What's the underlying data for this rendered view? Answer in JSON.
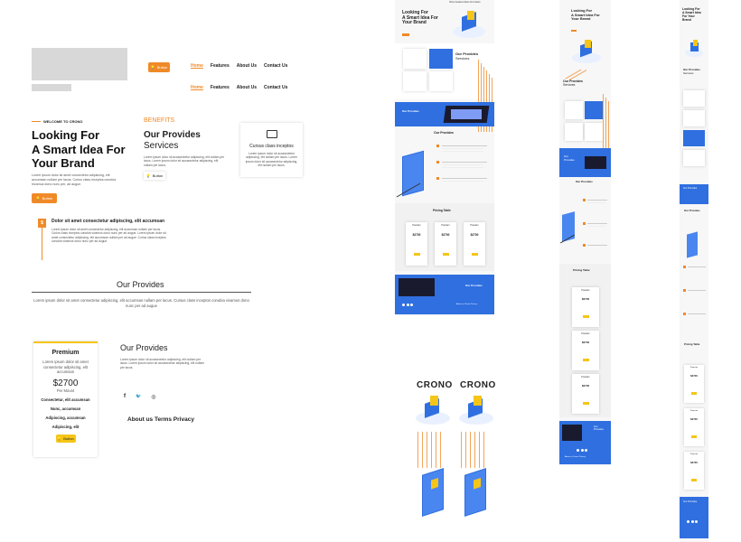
{
  "main": {
    "nav_a": {
      "home": "Home",
      "features": "Features",
      "about": "About Us",
      "contact": "Contact Us"
    },
    "nav_b": {
      "home": "Home",
      "features": "Features",
      "about": "About Us",
      "contact": "Contact Us"
    },
    "header_button": "Button",
    "hero": {
      "kicker": "WELCOME TO CRONO",
      "title_line1": "Looking For",
      "title_line2": "A Smart Idea For",
      "title_line3": "Your Brand",
      "body": "Lorem ipsum dolor sit amet consectetur adipiscing, elit accumsan nullam per lacus. Curlus class inceptos conubia hivamus dono nunc per, ad augue.",
      "button": "Button"
    },
    "benefits": {
      "kicker": "BENEFITS",
      "title_line1": "Our Provides",
      "title_line2": "Services",
      "body": "Lorem ipsum dolor sit accasectetur adipiscing, elit nullam per lacus. Lorem ipsum dolor sit accasectetur adipiscing, elit nullam per lacus.",
      "button": "Button"
    },
    "feature_card": {
      "title": "Cursus class inceptos",
      "body": "Lorem ipsum dolor sit accasectetur adipiscing, elit nullam per lacus. Lorem ipsum dolor sit accasectetur adipiscing, elit nullam per lacus."
    },
    "feature_item": {
      "icon_text": "$",
      "title": "Dolor sit amet consectetur adipiscing, elit accumsan",
      "body": "Lorem ipsum dolor sit amet consectetur adipiscing, elit accumsan nullam per lacus. Curlus class inceptos conubia vivamus dono nunc per ad augue. Lorem ipsum dolor sit amet consectetur adipiscing, elit accumsan nullam per ad augue. Curlus class inceptos conubia vivamus dono nunc per ad augue."
    },
    "provides": {
      "title": "Our Provides",
      "body": "Lorem ipsum dolor sit amet consectetur adipiscing, elit accumsan nullam per lacus. Cursus class inceptos conubia vivamus dono nunc per ad augue"
    },
    "pricing": {
      "name": "Premium",
      "desc": "Lorem ipsum dolor sit amet consectetur adipiscing, elit accumsan",
      "price": "$2700",
      "period": "Per Mount",
      "feature1": "Consectetur, elit accumsan",
      "feature2": "Nunc, accumsan",
      "feature3": "Adipiscing, accumsan",
      "feature4": "Adipiscing, elit",
      "button": "Button"
    },
    "provides2": {
      "title": "Our Provides",
      "body": "Lorem ipsum dolor sit accasectetur adipiscing, elit nullam per lacus. Lorem ipsum dolor sit accasectetur adipiscing, elit nullam per lacus."
    },
    "social": {
      "facebook": "f",
      "twitter": "🐦",
      "instagram": "◎"
    },
    "footer_links": "About us Terms Privacy"
  },
  "preview_desktop": {
    "hero_title_line1": "Looking For",
    "hero_title_line2": "A Smart Idea For",
    "hero_title_line3": "Your Brand",
    "services_title": "Our Provides",
    "services_sub": "Services",
    "blue_banner": "Our Provides",
    "provides": "Our Provides",
    "pricing_title": "Pricing Table",
    "plans": [
      {
        "name": "Premium",
        "price": "$2700"
      },
      {
        "name": "Premium",
        "price": "$2700"
      },
      {
        "name": "Premium",
        "price": "$2700"
      }
    ],
    "footer_banner": "Our Provides",
    "footer_links": "About us Terms Privacy"
  },
  "preview_tablet": {
    "hero_title_line1": "Looking For",
    "hero_title_line2": "A Smart Idea For",
    "hero_title_line3": "Your Brand",
    "services_title": "Our Provides",
    "services_sub": "Services",
    "blue_card": "Our Provides",
    "provides": "Our Provides",
    "pricing_title": "Pricing Table",
    "plans": [
      {
        "name": "Premium",
        "price": "$2700"
      },
      {
        "name": "Premium",
        "price": "$2700"
      },
      {
        "name": "Premium",
        "price": "$2700"
      }
    ],
    "footer_banner": "Our Provides",
    "footer_links": "About us Terms Privacy"
  },
  "preview_mobile": {
    "hero_title_line1": "Looking For",
    "hero_title_line2": "A Smart Idea",
    "hero_title_line3": "For Your",
    "hero_title_line4": "Brand",
    "services_title": "Our Provides",
    "services_sub": "Services",
    "blue_card": "Our Provides",
    "provides": "Our Provides",
    "pricing_title": "Pricing Table",
    "plans": [
      {
        "name": "Premium",
        "price": "$2700"
      },
      {
        "name": "Premium",
        "price": "$2700"
      },
      {
        "name": "Premium",
        "price": "$2700"
      }
    ],
    "footer_banner": "Our Provides"
  },
  "logos": {
    "logo1": "CRONO",
    "logo2": "CRONO"
  },
  "colors": {
    "accent": "#f08a28",
    "blue": "#2f6fe0",
    "yellow": "#f5c518"
  }
}
